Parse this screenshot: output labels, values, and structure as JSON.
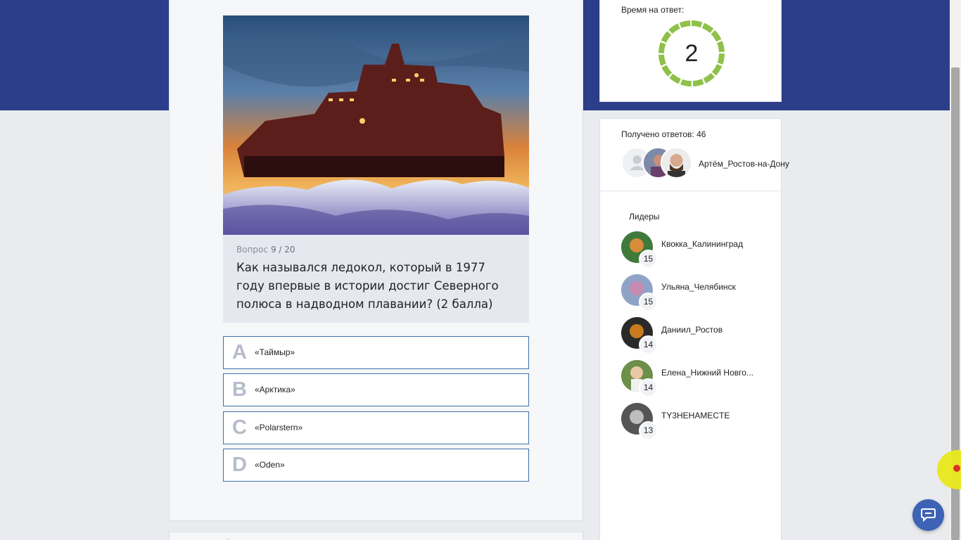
{
  "question": {
    "counter_label": "Вопрос",
    "counter": "9 / 20",
    "text": "Как назывался ледокол, который в 1977 году впервые в истории достиг Северного полюса в надводном плавании? (2 балла)"
  },
  "answers": [
    {
      "letter": "A",
      "text": "«Таймыр»"
    },
    {
      "letter": "B",
      "text": "«Арктика»"
    },
    {
      "letter": "C",
      "text": "«Polarstern»"
    },
    {
      "letter": "D",
      "text": "«Oden»"
    }
  ],
  "timer": {
    "title": "Время на ответ:",
    "value": "2",
    "color": "#8fc14a"
  },
  "responses": {
    "title": "Получено ответов: 46",
    "last_user": "Артём_Ростов-на-Дону"
  },
  "leaders": {
    "title": "Лидеры",
    "items": [
      {
        "name": "Квокка_Калининград",
        "score": "15"
      },
      {
        "name": "Ульяна_Челябинск",
        "score": "15"
      },
      {
        "name": "Даниил_Ростов",
        "score": "14"
      },
      {
        "name": "Елена_Нижний Новго...",
        "score": "14"
      },
      {
        "name": "TY3HEHAMECTE",
        "score": "13"
      }
    ]
  },
  "colors": {
    "banner": "#2c3e8a",
    "answer_border": "#3f6fa8",
    "chat_button": "#3e63b5"
  },
  "icons": {
    "chat": "chat-bubble-icon",
    "placeholder_avatar": "user-placeholder-icon"
  }
}
